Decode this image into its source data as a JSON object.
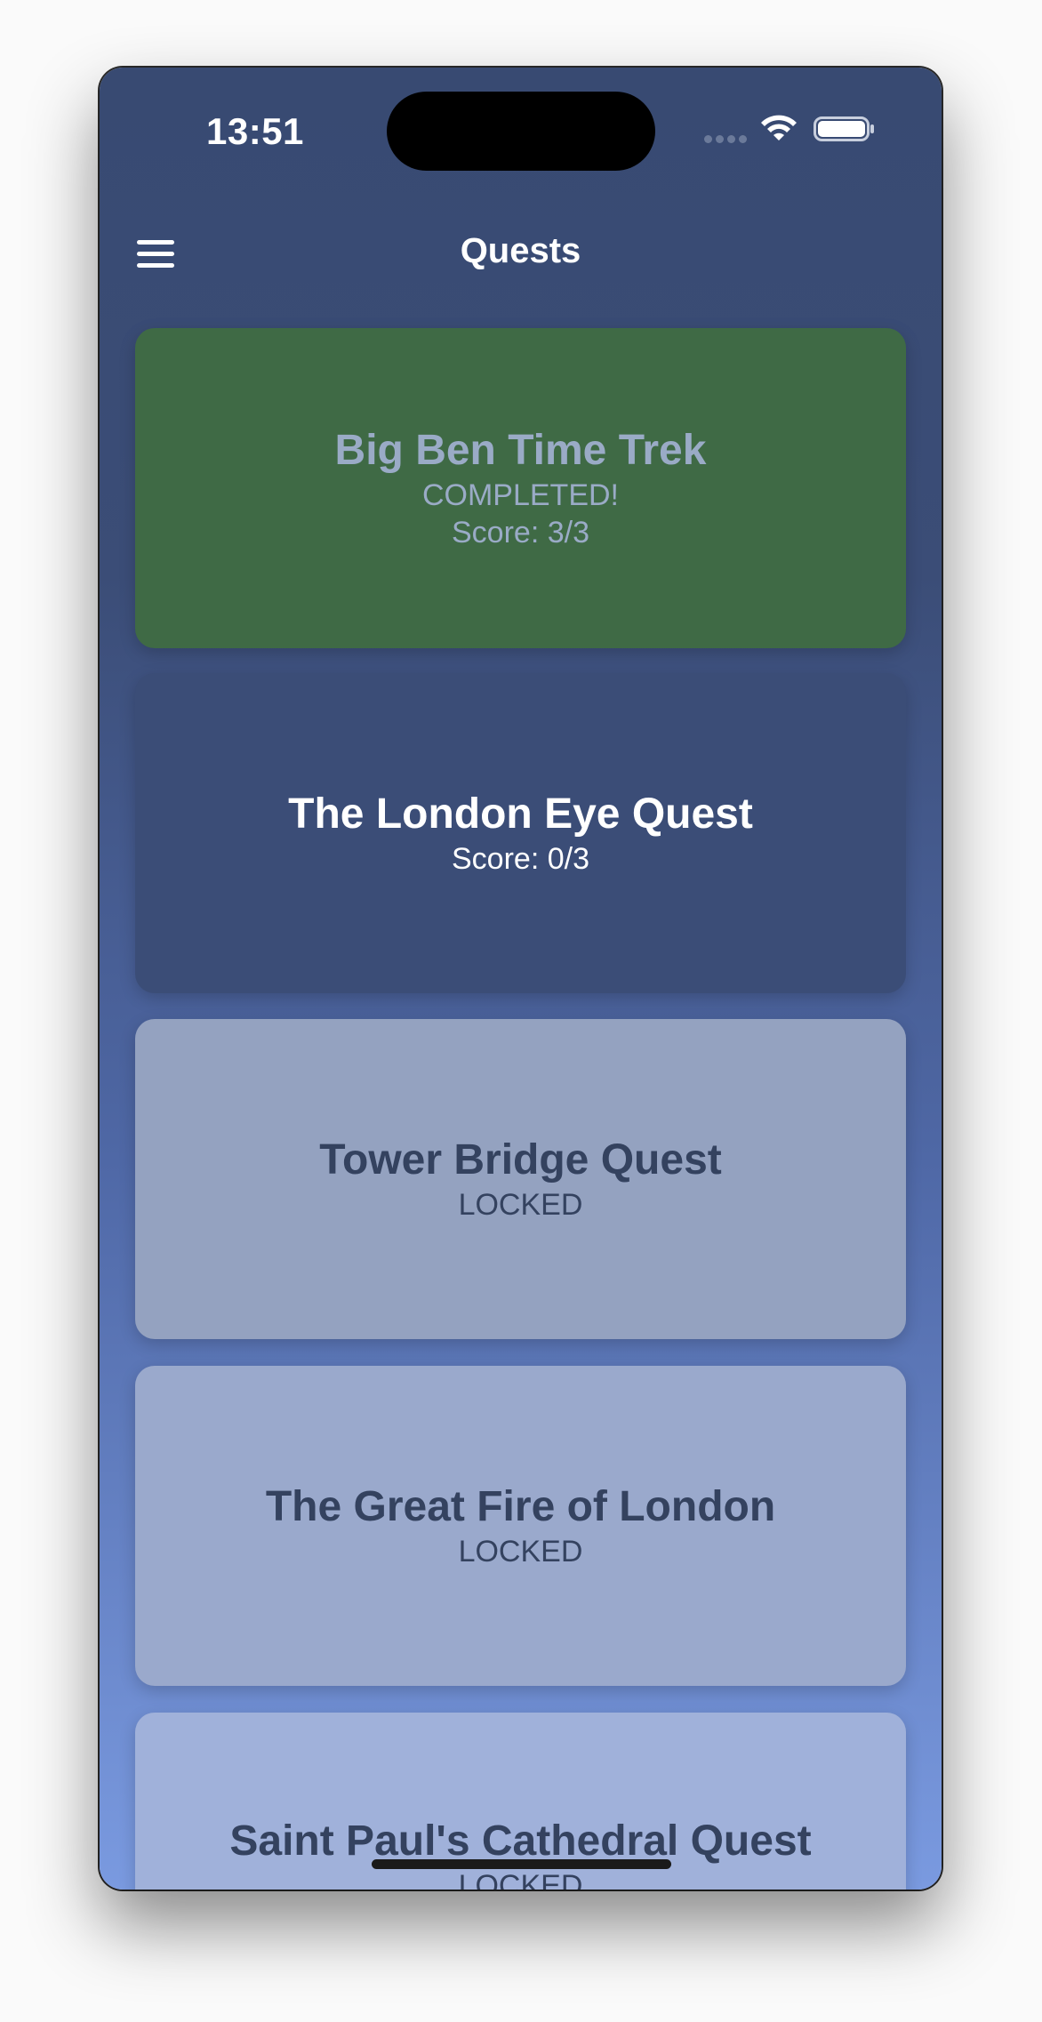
{
  "status_bar": {
    "time": "13:51",
    "icons": [
      "cellular-signal-icon",
      "wifi-icon",
      "battery-icon"
    ]
  },
  "nav": {
    "title": "Quests",
    "menu_icon": "hamburger-menu-icon"
  },
  "quests": [
    {
      "title": "Big Ben Time Trek",
      "status": "COMPLETED!",
      "score": "Score: 3/3",
      "state": "completed",
      "color": "#3f6a45"
    },
    {
      "title": "The London Eye Quest",
      "score": "Score: 0/3",
      "state": "available",
      "color": "#3b4d77"
    },
    {
      "title": "Tower Bridge Quest",
      "status": "LOCKED",
      "state": "locked",
      "color": "#94a2c0"
    },
    {
      "title": "The Great Fire of London",
      "status": "LOCKED",
      "state": "locked",
      "color": "#9aa9cc"
    },
    {
      "title": "Saint Paul's Cathedral Quest",
      "status": "LOCKED",
      "state": "locked",
      "color": "#a0b1da"
    }
  ],
  "colors": {
    "background_top": "#384a72",
    "background_bottom": "#7a9ae0",
    "completed": "#3f6a45",
    "available": "#3b4d77",
    "locked_text": "#34425f"
  }
}
